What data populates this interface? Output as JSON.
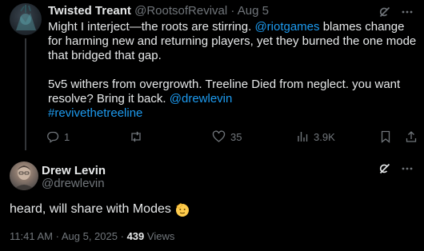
{
  "reply_post": {
    "author_name": "Twisted Treant",
    "author_handle": "@RootsofRevival",
    "separator": "·",
    "date": "Aug 5",
    "text_part1": "Might I interject—the roots are stirring. ",
    "mention1": "@riotgames",
    "text_part2": " blames change for harming new and returning players, yet they burned the one mode that bridged that gap.",
    "text_part3": "5v5 withers from overgrowth. Treeline Died from neglect. you want resolve? Bring it back. ",
    "mention2": "@drewlevin",
    "hashtag": "#revivethetreeline",
    "actions": {
      "replies": "1",
      "reposts": "",
      "likes": "35",
      "views": "3.9K"
    }
  },
  "main_post": {
    "author_name": "Drew Levin",
    "author_handle": "@drewlevin",
    "text": "heard, will share with Modes",
    "emoji": "saluting-face",
    "time": "11:41 AM",
    "separator": "·",
    "date": "Aug 5, 2025",
    "views_count": "439",
    "views_label": "Views"
  },
  "colors": {
    "background": "#000000",
    "text": "#e7e9ea",
    "muted": "#71767b",
    "link": "#1d9bf0",
    "emoji_yellow": "#ffcc4d"
  }
}
